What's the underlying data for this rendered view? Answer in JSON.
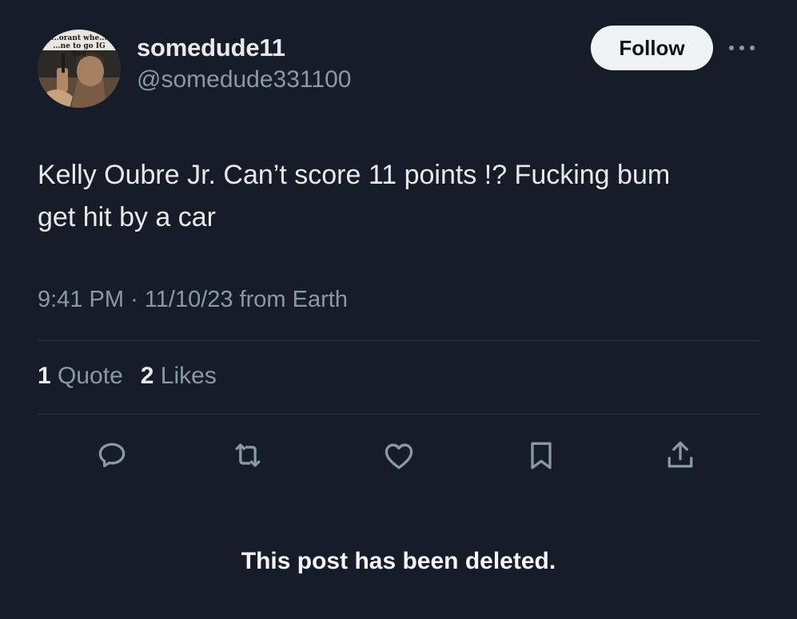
{
  "post": {
    "author": {
      "display_name": "somedude11",
      "handle": "@somedude331100",
      "avatar_caption": "...orant whe... ...ne to go IG live"
    },
    "follow_label": "Follow",
    "more_icon": "more-dots-icon",
    "text": "Kelly Oubre Jr. Can’t score 11 points !? Fucking bum\nget hit by a car",
    "meta": {
      "time": "9:41 PM",
      "separator": "·",
      "date": "11/10/23",
      "source": "from Earth"
    },
    "stats": {
      "quotes_count": "1",
      "quotes_label": "Quote",
      "likes_count": "2",
      "likes_label": "Likes"
    },
    "actions": [
      {
        "name": "reply",
        "icon": "reply-icon"
      },
      {
        "name": "repost",
        "icon": "repost-icon"
      },
      {
        "name": "like",
        "icon": "heart-icon"
      },
      {
        "name": "bookmark",
        "icon": "bookmark-icon"
      },
      {
        "name": "share",
        "icon": "share-icon"
      }
    ],
    "deleted_notice": "This post has been deleted."
  },
  "colors": {
    "background": "#161d29",
    "primary_text": "#e7e9ea",
    "secondary_text": "#8b98a5",
    "divider": "#2f3640",
    "follow_bg": "#eff3f4"
  }
}
